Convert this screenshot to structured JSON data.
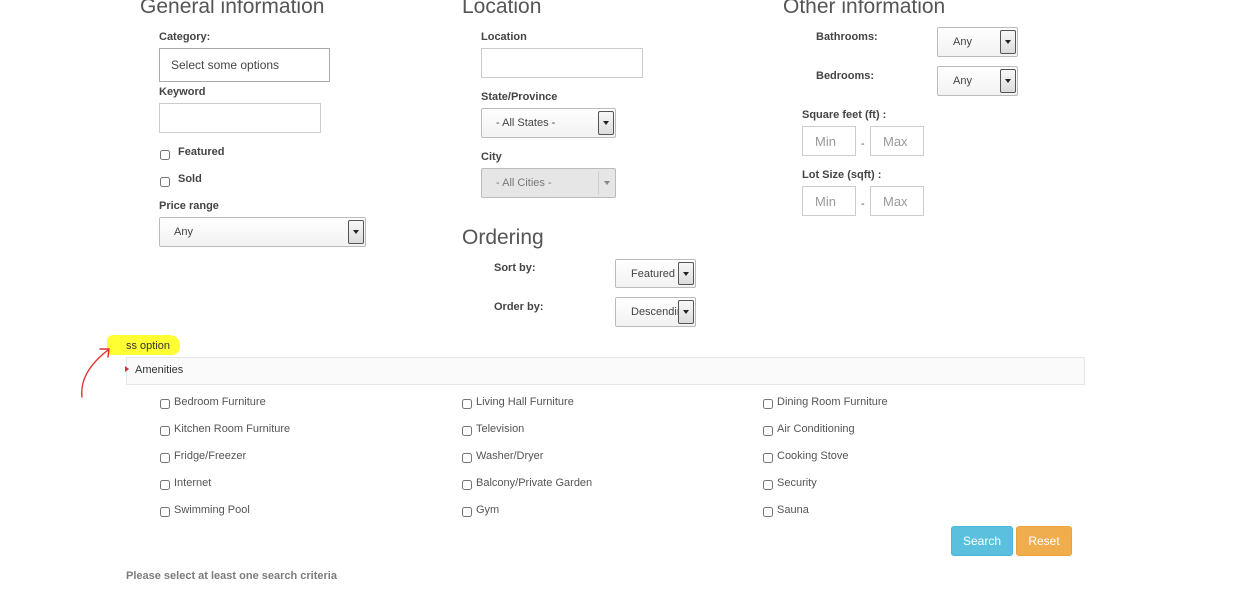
{
  "general": {
    "title": "General information",
    "category_label": "Category:",
    "category_placeholder": "Select some options",
    "keyword_label": "Keyword",
    "keyword_value": "",
    "featured_label": "Featured",
    "sold_label": "Sold",
    "price_label": "Price range",
    "price_value": "Any"
  },
  "location": {
    "title": "Location",
    "location_label": "Location",
    "location_value": "",
    "state_label": "State/Province",
    "state_value": "- All States -",
    "city_label": "City",
    "city_value": "- All Cities -"
  },
  "ordering": {
    "title": "Ordering",
    "sort_label": "Sort by:",
    "sort_value": "Featured",
    "order_label": "Order by:",
    "order_value": "Descending"
  },
  "other": {
    "title": "Other information",
    "bathrooms_label": "Bathrooms:",
    "bathrooms_value": "Any",
    "bedrooms_label": "Bedrooms:",
    "bedrooms_value": "Any",
    "sqft_label": "Square feet (ft) :",
    "lot_label": "Lot Size (sqft) :",
    "min_placeholder": "Min",
    "max_placeholder": "Max",
    "dash": "-"
  },
  "highlight": {
    "text": "ss option",
    "color": "#ffff33"
  },
  "annotation": {
    "arrow_color": "#e03030"
  },
  "amenities": {
    "title": "Amenities",
    "items": [
      "Bedroom Furniture",
      "Living Hall Furniture",
      "Dining Room Furniture",
      "Kitchen Room Furniture",
      "Television",
      "Air Conditioning",
      "Fridge/Freezer",
      "Washer/Dryer",
      "Cooking Stove",
      "Internet",
      "Balcony/Private Garden",
      "Security",
      "Swimming Pool",
      "Gym",
      "Sauna"
    ]
  },
  "buttons": {
    "search": "Search",
    "search_color": "#5bc0de",
    "reset": "Reset",
    "reset_color": "#f0ad4e"
  },
  "footer": {
    "note": "Please select at least one search criteria"
  }
}
